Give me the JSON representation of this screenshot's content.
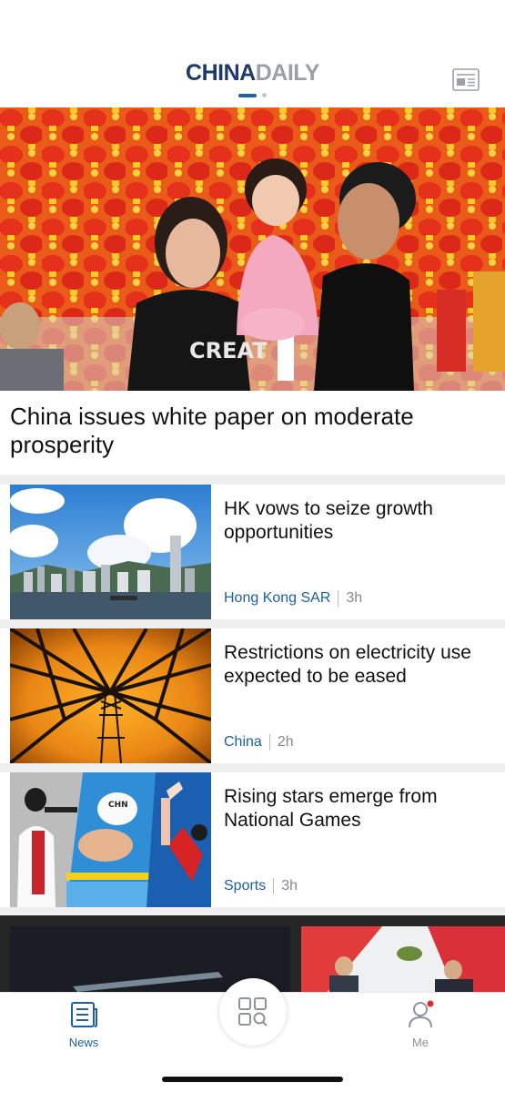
{
  "header": {
    "logo_china": "CHINA",
    "logo_daily": "DAILY",
    "page_indicator": {
      "total": 2,
      "active": 1
    },
    "paper_icon": "newspaper-icon"
  },
  "hero": {
    "title": "China issues white paper on moderate prosperity",
    "image": "family-with-red-lanterns-photo",
    "shirt_text": "CREAT"
  },
  "articles": [
    {
      "title": "HK vows to seize growth opportunities",
      "category": "Hong Kong SAR",
      "time": "3h",
      "image": "hong-kong-skyline-photo"
    },
    {
      "title": "Restrictions on electricity use expected to be eased",
      "category": "China",
      "time": "2h",
      "image": "power-tower-sunset-photo"
    },
    {
      "title": "Rising stars emerge from National Games",
      "category": "Sports",
      "time": "3h",
      "image": "athletes-collage-photo",
      "swim_cap_text": "CHN"
    }
  ],
  "tabbar": {
    "news_label": "News",
    "me_label": "Me",
    "center_icon": "grid-search-icon",
    "accent": "#1d5fa8",
    "notification_color": "#e0282e"
  }
}
